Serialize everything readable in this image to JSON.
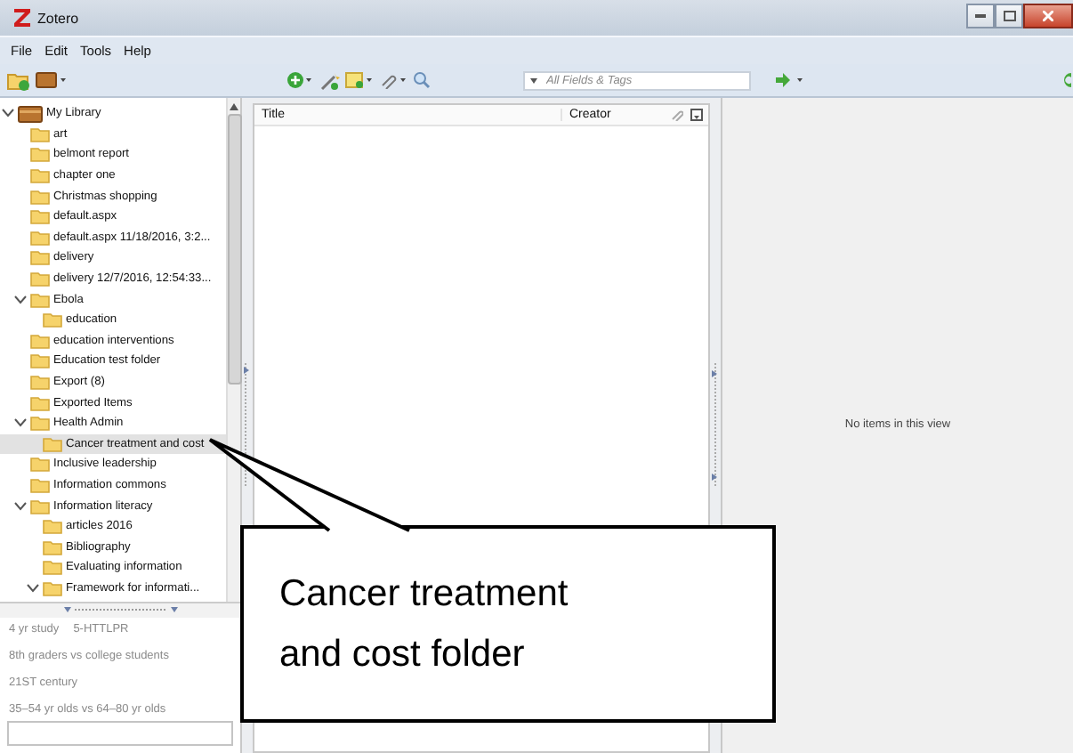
{
  "window": {
    "title": "Zotero"
  },
  "menu": [
    "File",
    "Edit",
    "Tools",
    "Help"
  ],
  "toolbar": {
    "search": {
      "placeholder": "All Fields & Tags"
    }
  },
  "collections": [
    {
      "label": "My Library",
      "kind": "library",
      "expanded": true,
      "selected": false,
      "children": [
        {
          "label": "art",
          "kind": "folder",
          "selected": false
        },
        {
          "label": "belmont report",
          "kind": "folder",
          "selected": false
        },
        {
          "label": "chapter one",
          "kind": "folder",
          "selected": false
        },
        {
          "label": "Christmas shopping",
          "kind": "folder",
          "selected": false
        },
        {
          "label": "default.aspx",
          "kind": "folder",
          "selected": false
        },
        {
          "label": "default.aspx 11/18/2016, 3:2...",
          "kind": "folder",
          "selected": false
        },
        {
          "label": "delivery",
          "kind": "folder",
          "selected": false
        },
        {
          "label": "delivery 12/7/2016, 12:54:33...",
          "kind": "folder",
          "selected": false
        },
        {
          "label": "Ebola",
          "kind": "folder",
          "expanded": true,
          "selected": false,
          "children": [
            {
              "label": "education",
              "kind": "folder",
              "selected": false
            }
          ]
        },
        {
          "label": "education interventions",
          "kind": "folder",
          "selected": false
        },
        {
          "label": "Education test folder",
          "kind": "folder",
          "selected": false
        },
        {
          "label": "Export (8)",
          "kind": "folder",
          "selected": false
        },
        {
          "label": "Exported Items",
          "kind": "folder",
          "selected": false
        },
        {
          "label": "Health Admin",
          "kind": "folder",
          "expanded": true,
          "selected": false,
          "children": [
            {
              "label": "Cancer treatment and cost",
              "kind": "folder",
              "selected": true
            }
          ]
        },
        {
          "label": "Inclusive leadership",
          "kind": "folder",
          "selected": false
        },
        {
          "label": "Information commons",
          "kind": "folder",
          "selected": false
        },
        {
          "label": "Information literacy",
          "kind": "folder",
          "expanded": true,
          "selected": false,
          "children": [
            {
              "label": "articles 2016",
              "kind": "folder",
              "selected": false
            },
            {
              "label": "Bibliography",
              "kind": "folder",
              "selected": false
            },
            {
              "label": "Evaluating information",
              "kind": "folder",
              "selected": false
            },
            {
              "label": "Framework for informati...",
              "kind": "folder",
              "expanded": true,
              "selected": false
            }
          ]
        }
      ]
    }
  ],
  "tags": [
    "4 yr study",
    "5-HTTLPR",
    "8th graders vs college students",
    "21ST century",
    "35–54 yr olds vs 64–80 yr olds"
  ],
  "items_table": {
    "columns": [
      "Title",
      "Creator"
    ]
  },
  "item_pane": {
    "message": "No items in this view"
  },
  "callout": {
    "lines": [
      "Cancer treatment",
      "and cost folder"
    ]
  }
}
